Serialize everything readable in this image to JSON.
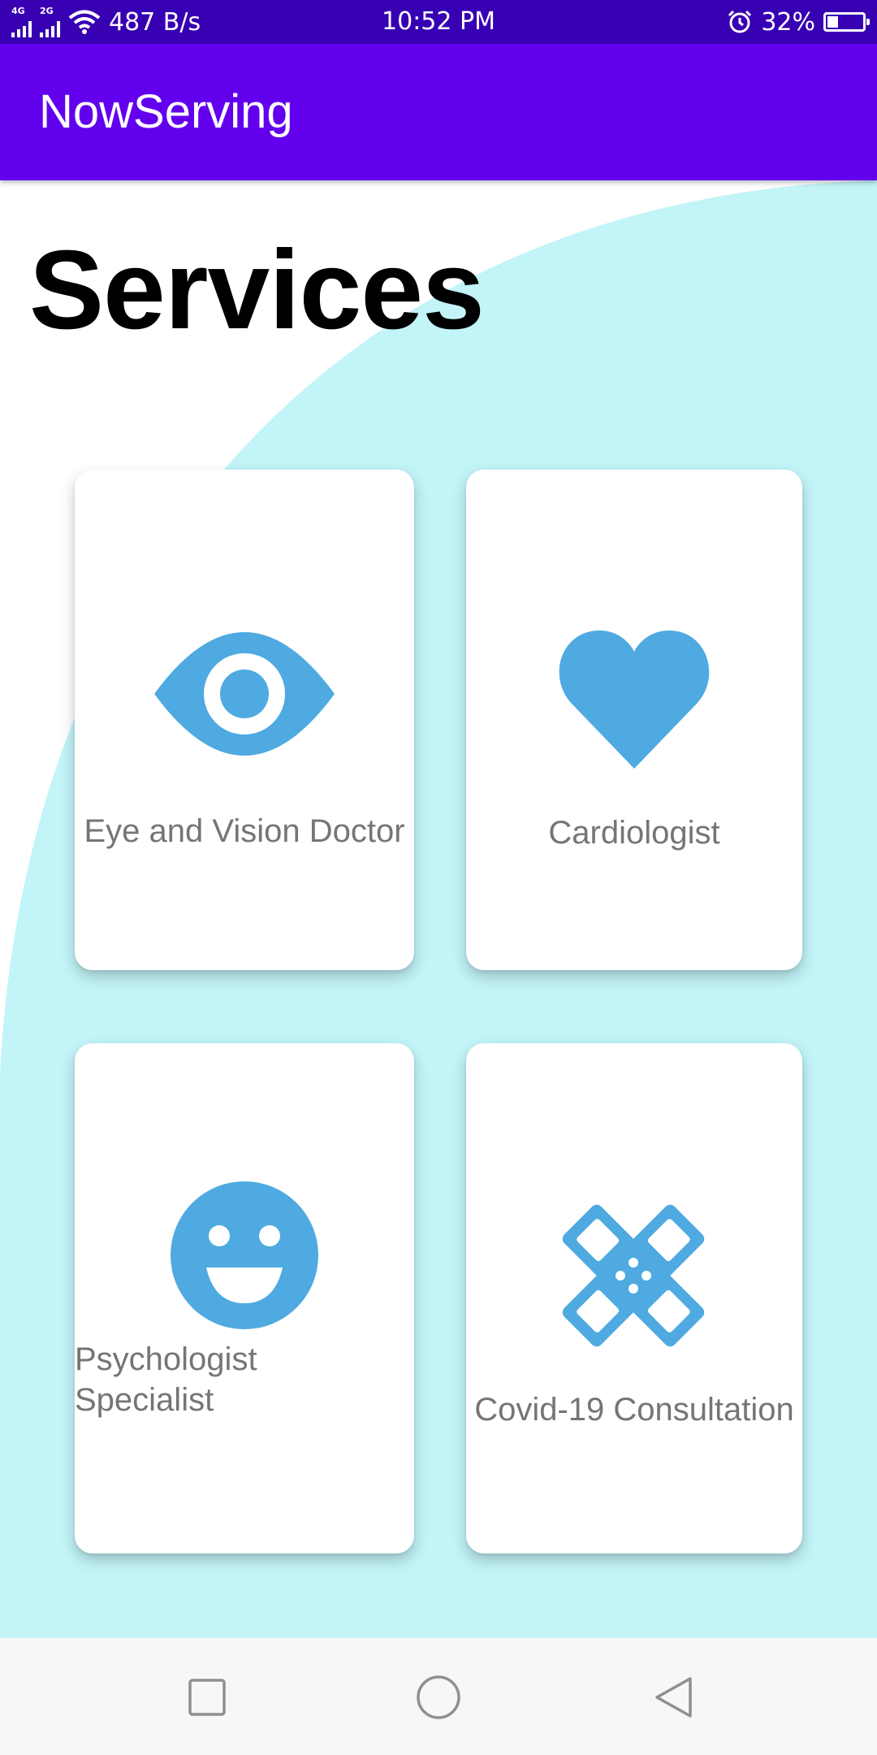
{
  "status_bar": {
    "network_1": "4G",
    "network_2": "2G",
    "speed": "487 B/s",
    "time": "10:52 PM",
    "battery": "32%",
    "battery_level": 0.32
  },
  "app_bar": {
    "title": "NowServing"
  },
  "page": {
    "title": "Services"
  },
  "colors": {
    "status_bar": "#3700b3",
    "app_bar": "#6200ee",
    "background_blob": "#c2f4f8",
    "icon": "#4eaae0",
    "label": "#757575"
  },
  "services": [
    {
      "label": "Eye and Vision Doctor",
      "icon": "eye-icon"
    },
    {
      "label": "Cardiologist",
      "icon": "heart-icon"
    },
    {
      "label": "Psychologist Specialist",
      "icon": "smiley-icon"
    },
    {
      "label": "Covid-19 Consultation",
      "icon": "bandage-icon"
    }
  ],
  "nav_bar": {
    "recents": "square-icon",
    "home": "circle-icon",
    "back": "triangle-back-icon"
  }
}
